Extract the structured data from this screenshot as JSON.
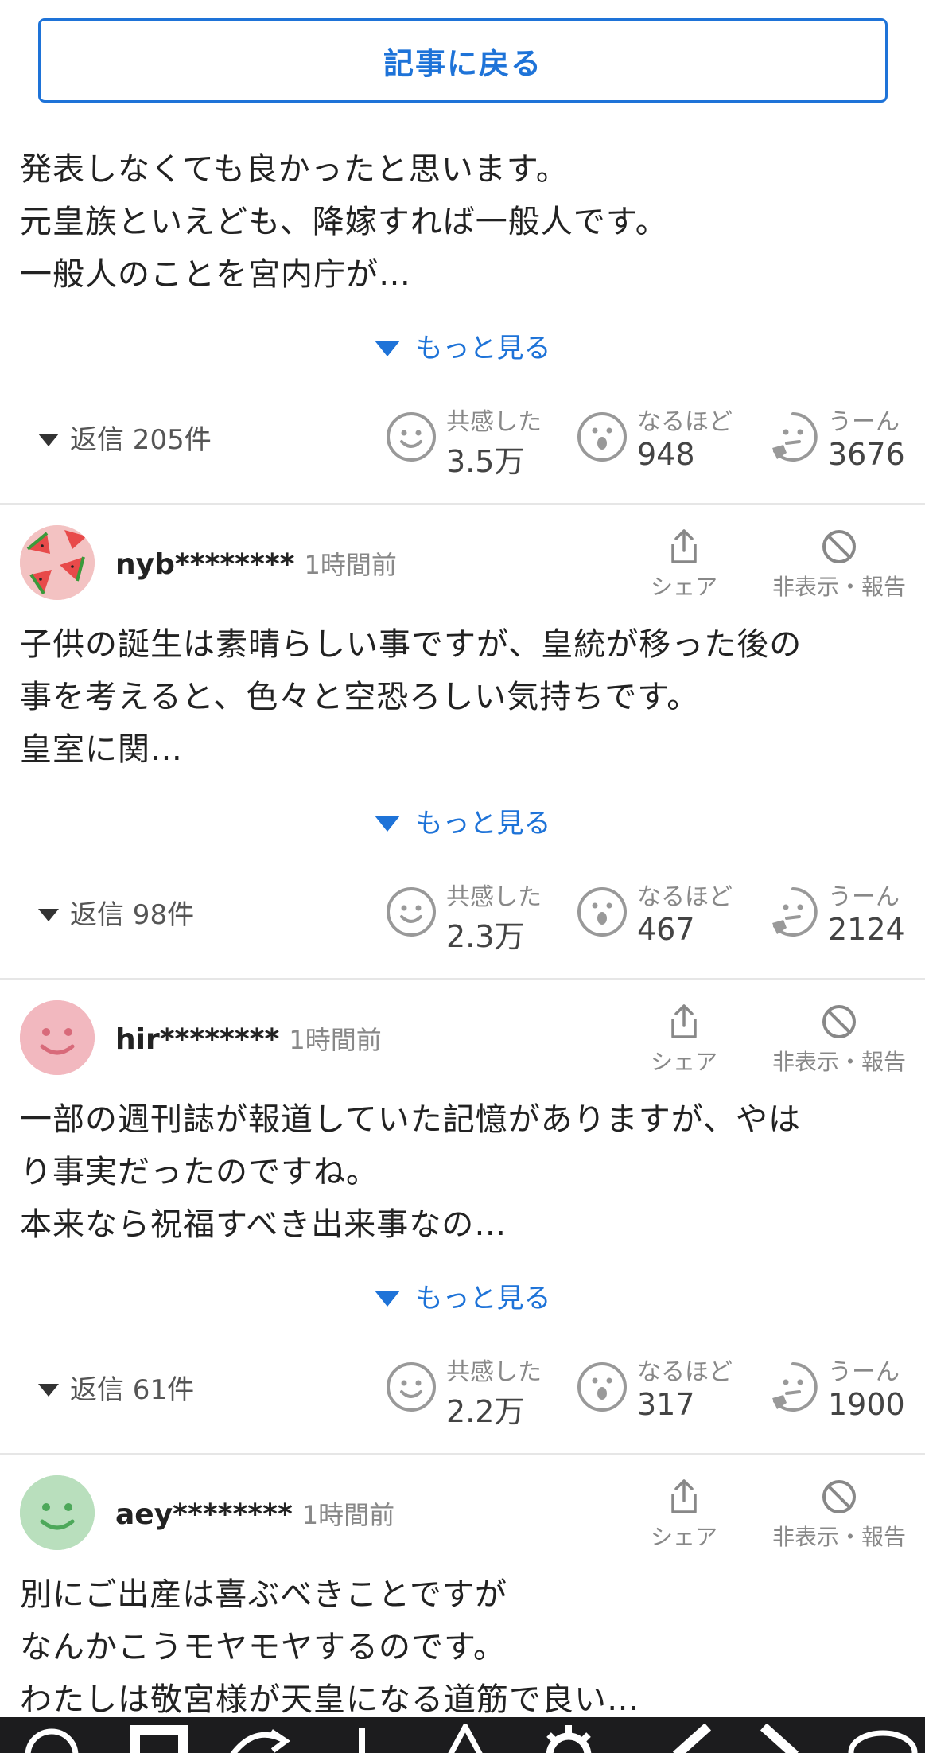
{
  "back_button": {
    "label": "記事に戻る"
  },
  "colors": {
    "accent": "#1e73d8",
    "text": "#222222",
    "muted": "#888888"
  },
  "first_comment": {
    "lines": [
      "発表しなくても良かったと思います。",
      "元皇族といえども、降嫁すれば一般人です。",
      "一般人のことを宮内庁が…"
    ],
    "more_label": "もっと見る",
    "replies_label": "返信 205件",
    "reactions": {
      "empathy_label": "共感した",
      "empathy_count": "3.5万",
      "naruhodo_label": "なるほど",
      "naruhodo_count": "948",
      "uun_label": "うーん",
      "uun_count": "3676"
    }
  },
  "comments": [
    {
      "user": "nyb********",
      "time": "1時間前",
      "avatar": "watermelon",
      "share_label": "シェア",
      "hide_label": "非表示・報告",
      "lines": [
        "子供の誕生は素晴らしい事ですが、皇統が移った後の",
        "事を考えると、色々と空恐ろしい気持ちです。",
        "皇室に関…"
      ],
      "more_label": "もっと見る",
      "replies_label": "返信 98件",
      "reactions": {
        "empathy_label": "共感した",
        "empathy_count": "2.3万",
        "naruhodo_label": "なるほど",
        "naruhodo_count": "467",
        "uun_label": "うーん",
        "uun_count": "2124"
      }
    },
    {
      "user": "hir********",
      "time": "1時間前",
      "avatar": "pink-smile",
      "share_label": "シェア",
      "hide_label": "非表示・報告",
      "lines": [
        "一部の週刊誌が報道していた記憶がありますが、やは",
        "り事実だったのですね。",
        "本来なら祝福すべき出来事なの…"
      ],
      "more_label": "もっと見る",
      "replies_label": "返信 61件",
      "reactions": {
        "empathy_label": "共感した",
        "empathy_count": "2.2万",
        "naruhodo_label": "なるほど",
        "naruhodo_count": "317",
        "uun_label": "うーん",
        "uun_count": "1900"
      }
    },
    {
      "user": "aey********",
      "time": "1時間前",
      "avatar": "green-smile",
      "share_label": "シェア",
      "hide_label": "非表示・報告",
      "lines": [
        "別にご出産は喜ぶべきことですが",
        "なんかこうモヤモヤするのです。",
        "わたしは敬宮様が天皇になる道筋で良い…"
      ]
    }
  ]
}
